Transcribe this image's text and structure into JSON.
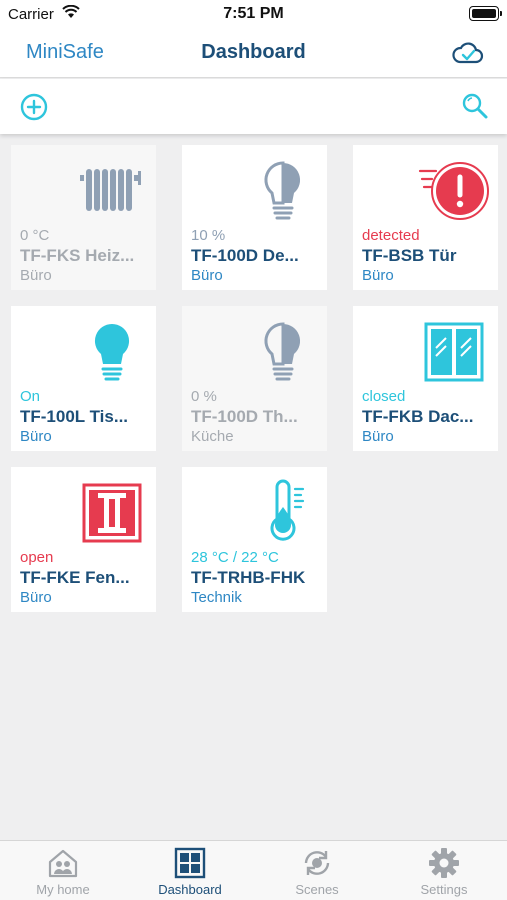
{
  "status_bar": {
    "carrier": "Carrier",
    "time": "7:51 PM"
  },
  "nav": {
    "left_label": "MiniSafe",
    "title": "Dashboard",
    "right_icon": "cloud-check-icon"
  },
  "toolbar": {
    "add_icon": "add-circle-icon",
    "search_icon": "search-icon"
  },
  "colors": {
    "accent": "#2e87c4",
    "navy": "#1d4f78",
    "cyan": "#2ec5dc",
    "red": "#e63b4f",
    "grey": "#a5aab0"
  },
  "tiles": [
    {
      "status": "0 °C",
      "name": "TF-FKS Heiz...",
      "room": "Büro",
      "icon": "radiator-icon"
    },
    {
      "status": "10 %",
      "name": "TF-100D De...",
      "room": "Büro",
      "icon": "dimmer-bulb-icon"
    },
    {
      "status": "detected",
      "name": "TF-BSB Tür",
      "room": "Büro",
      "icon": "alarm-alert-icon"
    },
    {
      "status": "On",
      "name": "TF-100L Tis...",
      "room": "Büro",
      "icon": "light-bulb-on-icon"
    },
    {
      "status": "0 %",
      "name": "TF-100D Th...",
      "room": "Küche",
      "icon": "dimmer-bulb-off-icon"
    },
    {
      "status": "closed",
      "name": "TF-FKB Dac...",
      "room": "Büro",
      "icon": "window-closed-icon"
    },
    {
      "status": "open",
      "name": "TF-FKE Fen...",
      "room": "Büro",
      "icon": "window-open-icon"
    },
    {
      "status": "28 °C / 22 °C",
      "name": "TF-TRHB-FHK",
      "room": "Technik",
      "icon": "thermometer-icon"
    }
  ],
  "tabs": [
    {
      "label": "My home",
      "icon": "house-icon",
      "active": false
    },
    {
      "label": "Dashboard",
      "icon": "grid-icon",
      "active": true
    },
    {
      "label": "Scenes",
      "icon": "scenes-icon",
      "active": false
    },
    {
      "label": "Settings",
      "icon": "gear-icon",
      "active": false
    }
  ]
}
